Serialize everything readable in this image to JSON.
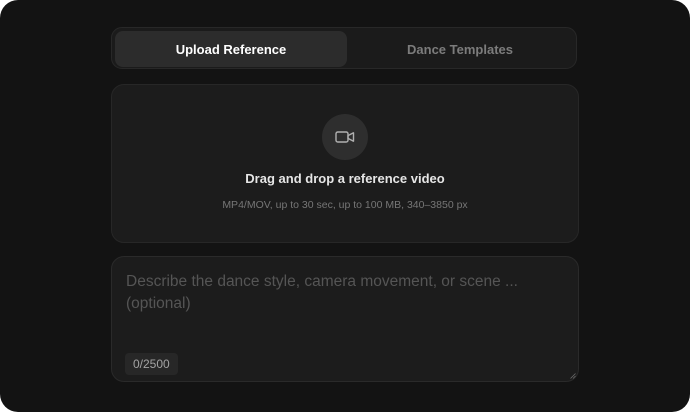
{
  "tabs": {
    "upload_label": "Upload Reference",
    "templates_label": "Dance Templates"
  },
  "dropzone": {
    "icon": "video-camera-icon",
    "title": "Drag and drop a reference video",
    "subtitle": "MP4/MOV, up to 30 sec, up to 100 MB, 340–3850 px"
  },
  "prompt": {
    "value": "",
    "placeholder": "Describe the dance style, camera movement, or scene ... (optional)",
    "counter": "0/2500"
  },
  "colors": {
    "background": "#131313",
    "panel": "#1c1c1c",
    "active_tab": "#2c2c2c"
  }
}
